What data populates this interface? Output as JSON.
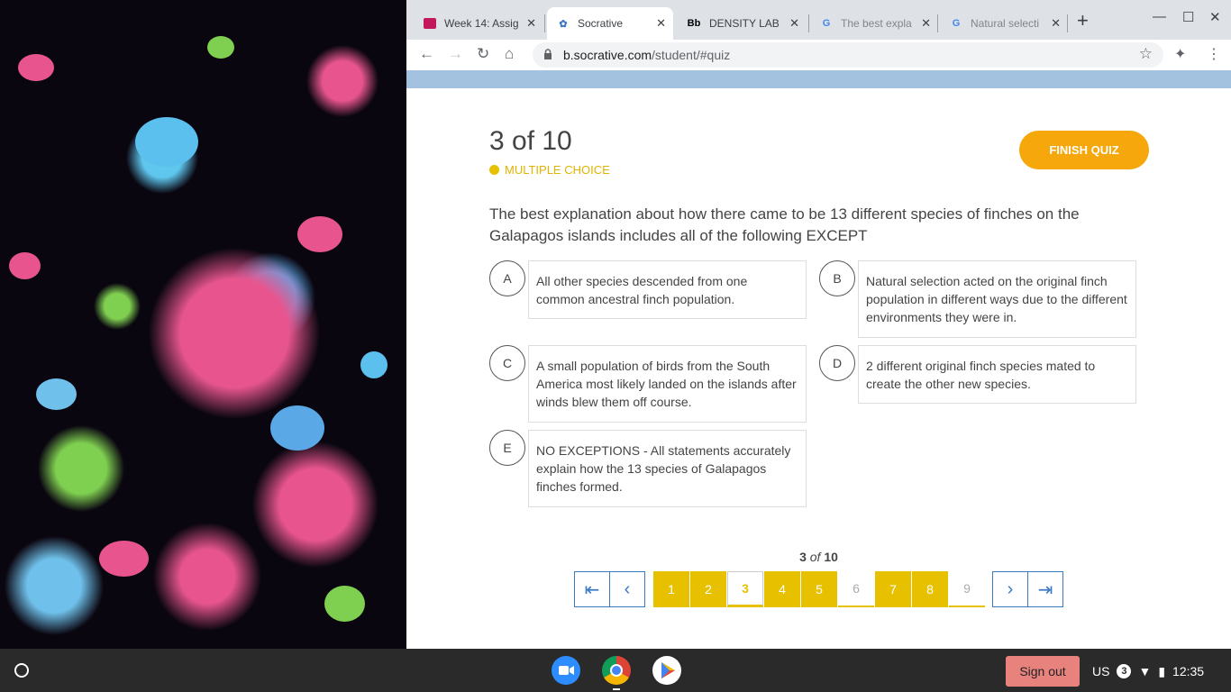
{
  "browser": {
    "tabs": [
      {
        "title": "Week 14: Assig",
        "icon": "classroom-icon"
      },
      {
        "title": "Socrative",
        "icon": "socrative-icon",
        "active": true
      },
      {
        "title": "DENSITY LAB",
        "icon": "blackboard-icon",
        "icon_text": "Bb"
      },
      {
        "title": "The best expla",
        "icon": "google-icon",
        "icon_text": "G"
      },
      {
        "title": "Natural selecti",
        "icon": "google-icon",
        "icon_text": "G"
      }
    ],
    "url_host": "b.socrative.com",
    "url_path": "/student/#quiz"
  },
  "quiz": {
    "count": "3 of 10",
    "type": "MULTIPLE CHOICE",
    "finish_label": "FINISH QUIZ",
    "question": "The best explanation about how there came to be 13 different species of finches on the Galapagos islands includes all of the following EXCEPT",
    "answers": [
      {
        "letter": "A",
        "text": "All other species descended from one common ancestral finch population."
      },
      {
        "letter": "B",
        "text": "Natural selection acted on the original finch population in different ways due to the different environments they were in."
      },
      {
        "letter": "C",
        "text": "A small population of birds from the South America most likely landed on the islands after winds blew them off course."
      },
      {
        "letter": "D",
        "text": "2 different original finch species mated to create the other new species."
      },
      {
        "letter": "E",
        "text": "NO EXCEPTIONS - All statements accurately explain how the 13 species of Galapagos finches formed."
      }
    ],
    "pager": {
      "current": "3",
      "of_word": "of",
      "total": "10",
      "pages": [
        "1",
        "2",
        "3",
        "4",
        "5",
        "6",
        "7",
        "8",
        "9"
      ]
    }
  },
  "shelf": {
    "signout_label": "Sign out",
    "locale": "US",
    "notifications": "3",
    "time": "12:35"
  },
  "colors": {
    "accent_yellow": "#e7c000",
    "finish_orange": "#f5a70b",
    "nav_blue": "#3b78c3",
    "banner_blue": "#a3c2e0"
  }
}
